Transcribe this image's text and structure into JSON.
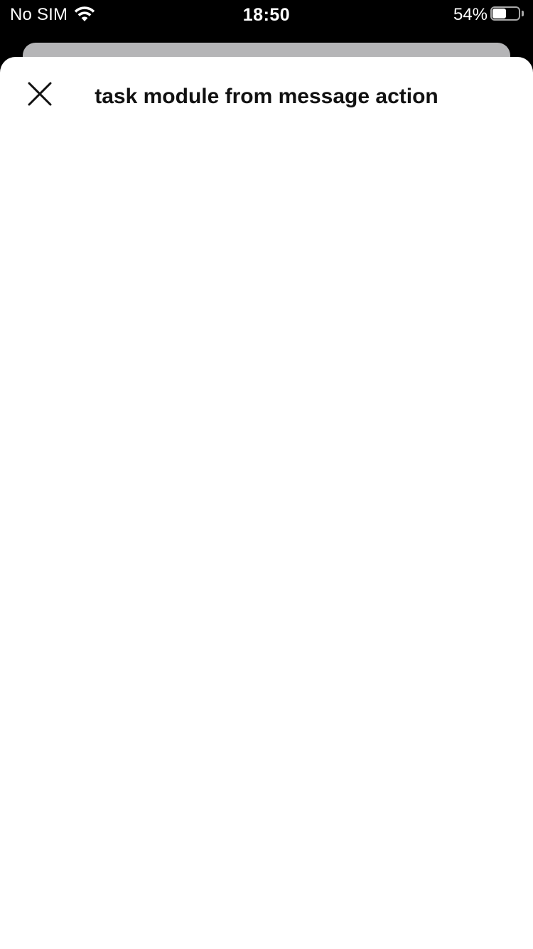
{
  "status_bar": {
    "carrier": "No SIM",
    "time": "18:50",
    "battery_percent_label": "54%",
    "battery_level": 0.54,
    "wifi_icon": "wifi-icon",
    "battery_icon": "battery-icon"
  },
  "modal": {
    "title": "task module from message action",
    "close_icon": "close-icon"
  },
  "colors": {
    "status_bar_background": "#000000",
    "sheet_background": "#ffffff",
    "back_card": "#b5b5b7",
    "title_text": "#111111"
  }
}
